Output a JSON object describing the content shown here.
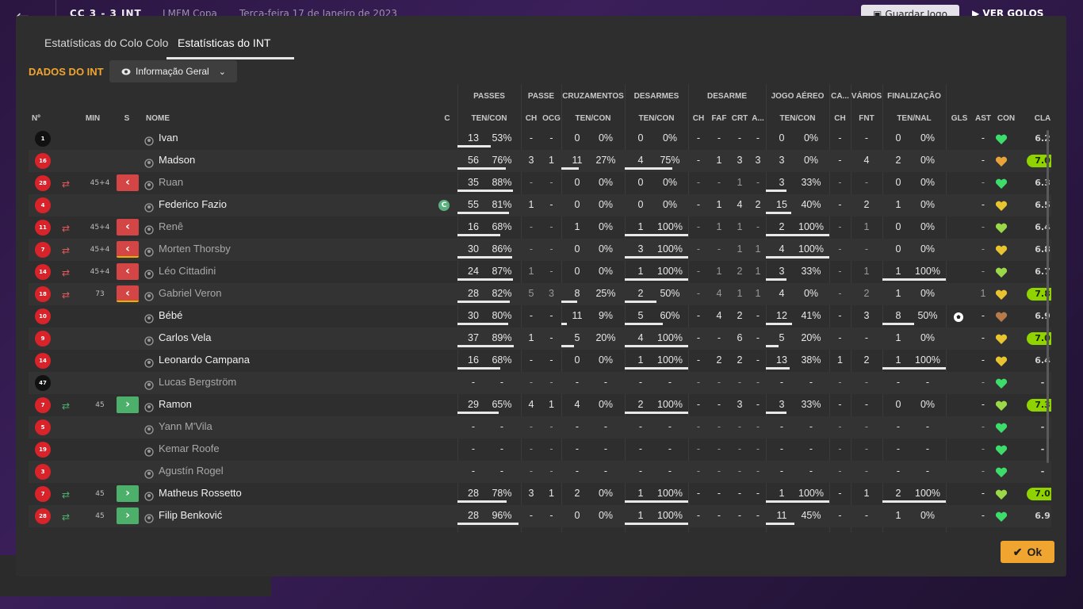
{
  "background": {
    "score": "CC 3 - 3 INT",
    "competition": "LMFM Copa",
    "date": "Terça-feira 17 de Janeiro de 2023",
    "save_label": "Guardar Jogo",
    "play_label": "VER GOLOS"
  },
  "tabs": [
    {
      "label": "Estatísticas do Colo Colo",
      "active": false
    },
    {
      "label": "Estatísticas do INT",
      "active": true
    }
  ],
  "section_title": "DADOS DO INT",
  "view_dropdown": {
    "selected": "Informação Geral",
    "icon": "eye-icon"
  },
  "headers": {
    "groups": {
      "passes": "PASSES",
      "passe": "PASSE",
      "cruzamentos": "CRUZAMENTOS",
      "desarmes": "DESARMES",
      "desarme": "DESARME",
      "jogo_aereo": "JOGO AÉREO",
      "ca": "CA...",
      "varios": "VÁRIOS",
      "finalizacao": "FINALIZAÇÃO"
    },
    "sub": {
      "num": "Nº",
      "min": "MIN",
      "s": "S",
      "name": "NOME",
      "c": "C",
      "passes": "TEN/CON",
      "passe_ch": "CH",
      "passe_ocg": "OCG",
      "cruz": "TEN/CON",
      "desarmes": "TEN/CON",
      "d_ch": "CH",
      "d_faf": "FAF",
      "d_crt": "CRT",
      "d_a": "A...",
      "aereo": "TEN/CON",
      "ca_ch": "CH",
      "fnt": "FNT",
      "fin": "TEN/NAL",
      "gls": "GLS",
      "ast": "AST",
      "con": "CON",
      "cla": "CLA"
    }
  },
  "colors": {
    "accent": "#f0a531",
    "sub_out": "#d44545",
    "sub_in": "#4caf6a",
    "rating_green": "#8fd400"
  },
  "players": [
    {
      "num": "1",
      "gk": true,
      "sub": "",
      "min": "",
      "name": "Ivan",
      "dim": false,
      "captain": false,
      "pa": "13",
      "pp": "53%",
      "pf": 0.53,
      "pch": "-",
      "pocg": "-",
      "ca": "0",
      "cp": "0%",
      "cf": 0,
      "da": "0",
      "dp": "0%",
      "df": 0,
      "dch": "-",
      "faf": "-",
      "crt": "-",
      "da2": "-",
      "aa": "0",
      "ap": "0%",
      "af": 0,
      "cach": "-",
      "fnt": "-",
      "fa": "0",
      "fp": "0%",
      "ff": 0,
      "gls": "",
      "ast": "-",
      "con": "green",
      "cla": "6.2",
      "cla_hi": false
    },
    {
      "num": "16",
      "gk": false,
      "sub": "",
      "min": "",
      "name": "Madson",
      "dim": false,
      "captain": false,
      "pa": "56",
      "pp": "76%",
      "pf": 0.76,
      "pch": "3",
      "pocg": "1",
      "ca": "11",
      "cp": "27%",
      "cf": 0.27,
      "da": "4",
      "dp": "75%",
      "df": 0.75,
      "dch": "-",
      "faf": "1",
      "crt": "3",
      "da2": "3",
      "aa": "3",
      "ap": "0%",
      "af": 0,
      "cach": "-",
      "fnt": "4",
      "fa": "2",
      "fp": "0%",
      "ff": 0,
      "gls": "",
      "ast": "-",
      "con": "orange",
      "cla": "7.0",
      "cla_hi": true
    },
    {
      "num": "28",
      "gk": false,
      "sub": "out",
      "min": "45+4",
      "name": "Ruan",
      "dim": true,
      "captain": false,
      "yellow": false,
      "pa": "35",
      "pp": "88%",
      "pf": 0.88,
      "pch": "-",
      "pocg": "-",
      "ca": "0",
      "cp": "0%",
      "cf": 0,
      "da": "0",
      "dp": "0%",
      "df": 0,
      "dch": "-",
      "faf": "-",
      "crt": "1",
      "da2": "-",
      "aa": "3",
      "ap": "33%",
      "af": 0.33,
      "cach": "-",
      "fnt": "-",
      "fa": "0",
      "fp": "0%",
      "ff": 0,
      "gls": "",
      "ast": "-",
      "con": "green",
      "cla": "6.3",
      "cla_hi": false
    },
    {
      "num": "4",
      "gk": false,
      "sub": "",
      "min": "",
      "name": "Federico Fazio",
      "dim": false,
      "captain": true,
      "pa": "55",
      "pp": "81%",
      "pf": 0.81,
      "pch": "1",
      "pocg": "-",
      "ca": "0",
      "cp": "0%",
      "cf": 0,
      "da": "0",
      "dp": "0%",
      "df": 0,
      "dch": "-",
      "faf": "1",
      "crt": "4",
      "da2": "2",
      "aa": "15",
      "ap": "40%",
      "af": 0.4,
      "cach": "-",
      "fnt": "2",
      "fa": "1",
      "fp": "0%",
      "ff": 0,
      "gls": "",
      "ast": "-",
      "con": "yellow",
      "cla": "6.5",
      "cla_hi": false
    },
    {
      "num": "11",
      "gk": false,
      "sub": "out",
      "min": "45+4",
      "name": "Renê",
      "dim": true,
      "captain": false,
      "yellow": false,
      "pa": "16",
      "pp": "68%",
      "pf": 0.68,
      "pch": "-",
      "pocg": "-",
      "ca": "1",
      "cp": "0%",
      "cf": 0,
      "da": "1",
      "dp": "100%",
      "df": 1,
      "dch": "-",
      "faf": "1",
      "crt": "1",
      "da2": "-",
      "aa": "2",
      "ap": "100%",
      "af": 1,
      "cach": "-",
      "fnt": "1",
      "fa": "0",
      "fp": "0%",
      "ff": 0,
      "gls": "",
      "ast": "-",
      "con": "lime",
      "cla": "6.4",
      "cla_hi": false
    },
    {
      "num": "7",
      "gk": false,
      "sub": "out",
      "min": "45+4",
      "name": "Morten Thorsby",
      "dim": true,
      "captain": false,
      "yellow": true,
      "pa": "30",
      "pp": "86%",
      "pf": 0.86,
      "pch": "-",
      "pocg": "-",
      "ca": "0",
      "cp": "0%",
      "cf": 0,
      "da": "3",
      "dp": "100%",
      "df": 1,
      "dch": "-",
      "faf": "-",
      "crt": "1",
      "da2": "1",
      "aa": "4",
      "ap": "100%",
      "af": 1,
      "cach": "-",
      "fnt": "-",
      "fa": "0",
      "fp": "0%",
      "ff": 0,
      "gls": "",
      "ast": "-",
      "con": "yellow",
      "cla": "6.8",
      "cla_hi": false
    },
    {
      "num": "14",
      "gk": false,
      "sub": "out",
      "min": "45+4",
      "name": "Léo Cittadini",
      "dim": true,
      "captain": false,
      "yellow": false,
      "pa": "24",
      "pp": "87%",
      "pf": 0.87,
      "pch": "1",
      "pocg": "-",
      "ca": "0",
      "cp": "0%",
      "cf": 0,
      "da": "1",
      "dp": "100%",
      "df": 1,
      "dch": "-",
      "faf": "1",
      "crt": "2",
      "da2": "1",
      "aa": "3",
      "ap": "33%",
      "af": 0.33,
      "cach": "-",
      "fnt": "1",
      "fa": "1",
      "fp": "100%",
      "ff": 1,
      "gls": "",
      "ast": "-",
      "con": "lime",
      "cla": "6.7",
      "cla_hi": false
    },
    {
      "num": "18",
      "gk": false,
      "sub": "out",
      "min": "73",
      "name": "Gabriel Veron",
      "dim": true,
      "captain": false,
      "yellow": true,
      "pa": "28",
      "pp": "82%",
      "pf": 0.82,
      "pch": "5",
      "pocg": "3",
      "ca": "8",
      "cp": "25%",
      "cf": 0.25,
      "da": "2",
      "dp": "50%",
      "df": 0.5,
      "dch": "-",
      "faf": "4",
      "crt": "1",
      "da2": "1",
      "aa": "4",
      "ap": "0%",
      "af": 0,
      "cach": "-",
      "fnt": "2",
      "fa": "1",
      "fp": "0%",
      "ff": 0,
      "gls": "",
      "ast": "1",
      "con": "yellow",
      "cla": "7.8",
      "cla_hi": true
    },
    {
      "num": "10",
      "gk": false,
      "sub": "",
      "min": "",
      "name": "Bébé",
      "dim": false,
      "captain": false,
      "pa": "30",
      "pp": "80%",
      "pf": 0.8,
      "pch": "-",
      "pocg": "-",
      "ca": "11",
      "cp": "9%",
      "cf": 0.09,
      "da": "5",
      "dp": "60%",
      "df": 0.6,
      "dch": "-",
      "faf": "4",
      "crt": "2",
      "da2": "-",
      "aa": "12",
      "ap": "41%",
      "af": 0.41,
      "cach": "-",
      "fnt": "3",
      "fa": "8",
      "fp": "50%",
      "ff": 0.5,
      "gls": "ball",
      "ast": "-",
      "con": "brown",
      "cla": "6.9",
      "cla_hi": false
    },
    {
      "num": "9",
      "gk": false,
      "sub": "",
      "min": "",
      "name": "Carlos Vela",
      "dim": false,
      "captain": false,
      "pa": "37",
      "pp": "89%",
      "pf": 0.89,
      "pch": "1",
      "pocg": "-",
      "ca": "5",
      "cp": "20%",
      "cf": 0.2,
      "da": "4",
      "dp": "100%",
      "df": 1,
      "dch": "-",
      "faf": "-",
      "crt": "6",
      "da2": "-",
      "aa": "5",
      "ap": "20%",
      "af": 0.2,
      "cach": "-",
      "fnt": "-",
      "fa": "1",
      "fp": "0%",
      "ff": 0,
      "gls": "",
      "ast": "-",
      "con": "yellow",
      "cla": "7.0",
      "cla_hi": true
    },
    {
      "num": "14",
      "gk": false,
      "sub": "",
      "min": "",
      "name": "Leonardo Campana",
      "dim": false,
      "captain": false,
      "pa": "16",
      "pp": "68%",
      "pf": 0.68,
      "pch": "-",
      "pocg": "-",
      "ca": "0",
      "cp": "0%",
      "cf": 0,
      "da": "1",
      "dp": "100%",
      "df": 1,
      "dch": "-",
      "faf": "2",
      "crt": "2",
      "da2": "-",
      "aa": "13",
      "ap": "38%",
      "af": 0.38,
      "cach": "1",
      "fnt": "2",
      "fa": "1",
      "fp": "100%",
      "ff": 1,
      "gls": "",
      "ast": "-",
      "con": "yellow",
      "cla": "6.4",
      "cla_hi": false
    },
    {
      "num": "47",
      "gk": true,
      "sub": "",
      "min": "",
      "name": "Lucas Bergström",
      "dim": true,
      "captain": false,
      "pa": "-",
      "pp": "-",
      "pf": 0,
      "pch": "-",
      "pocg": "-",
      "ca": "-",
      "cp": "-",
      "cf": 0,
      "da": "-",
      "dp": "-",
      "df": 0,
      "dch": "-",
      "faf": "-",
      "crt": "-",
      "da2": "-",
      "aa": "-",
      "ap": "-",
      "af": 0,
      "cach": "-",
      "fnt": "-",
      "fa": "-",
      "fp": "-",
      "ff": 0,
      "gls": "",
      "ast": "-",
      "con": "green",
      "cla": "-",
      "cla_hi": false
    },
    {
      "num": "7",
      "gk": false,
      "sub": "in",
      "min": "45",
      "name": "Ramon",
      "dim": false,
      "captain": false,
      "pa": "29",
      "pp": "65%",
      "pf": 0.65,
      "pch": "4",
      "pocg": "1",
      "ca": "4",
      "cp": "0%",
      "cf": 0,
      "da": "2",
      "dp": "100%",
      "df": 1,
      "dch": "-",
      "faf": "-",
      "crt": "3",
      "da2": "-",
      "aa": "3",
      "ap": "33%",
      "af": 0.33,
      "cach": "-",
      "fnt": "-",
      "fa": "0",
      "fp": "0%",
      "ff": 0,
      "gls": "",
      "ast": "-",
      "con": "lime",
      "cla": "7.3",
      "cla_hi": true
    },
    {
      "num": "5",
      "gk": false,
      "sub": "",
      "min": "",
      "name": "Yann M'Vila",
      "dim": true,
      "captain": false,
      "pa": "-",
      "pp": "-",
      "pf": 0,
      "pch": "-",
      "pocg": "-",
      "ca": "-",
      "cp": "-",
      "cf": 0,
      "da": "-",
      "dp": "-",
      "df": 0,
      "dch": "-",
      "faf": "-",
      "crt": "-",
      "da2": "-",
      "aa": "-",
      "ap": "-",
      "af": 0,
      "cach": "-",
      "fnt": "-",
      "fa": "-",
      "fp": "-",
      "ff": 0,
      "gls": "",
      "ast": "-",
      "con": "green",
      "cla": "-",
      "cla_hi": false
    },
    {
      "num": "19",
      "gk": false,
      "sub": "",
      "min": "",
      "name": "Kemar Roofe",
      "dim": true,
      "captain": false,
      "pa": "-",
      "pp": "-",
      "pf": 0,
      "pch": "-",
      "pocg": "-",
      "ca": "-",
      "cp": "-",
      "cf": 0,
      "da": "-",
      "dp": "-",
      "df": 0,
      "dch": "-",
      "faf": "-",
      "crt": "-",
      "da2": "-",
      "aa": "-",
      "ap": "-",
      "af": 0,
      "cach": "-",
      "fnt": "-",
      "fa": "-",
      "fp": "-",
      "ff": 0,
      "gls": "",
      "ast": "-",
      "con": "green",
      "cla": "-",
      "cla_hi": false
    },
    {
      "num": "3",
      "gk": false,
      "sub": "",
      "min": "",
      "name": "Agustín Rogel",
      "dim": true,
      "captain": false,
      "pa": "-",
      "pp": "-",
      "pf": 0,
      "pch": "-",
      "pocg": "-",
      "ca": "-",
      "cp": "-",
      "cf": 0,
      "da": "-",
      "dp": "-",
      "df": 0,
      "dch": "-",
      "faf": "-",
      "crt": "-",
      "da2": "-",
      "aa": "-",
      "ap": "-",
      "af": 0,
      "cach": "-",
      "fnt": "-",
      "fa": "-",
      "fp": "-",
      "ff": 0,
      "gls": "",
      "ast": "-",
      "con": "green",
      "cla": "-",
      "cla_hi": false
    },
    {
      "num": "7",
      "gk": false,
      "sub": "in",
      "min": "45",
      "name": "Matheus Rossetto",
      "dim": false,
      "captain": false,
      "pa": "28",
      "pp": "78%",
      "pf": 0.78,
      "pch": "3",
      "pocg": "1",
      "ca": "2",
      "cp": "0%",
      "cf": 0,
      "da": "1",
      "dp": "100%",
      "df": 1,
      "dch": "-",
      "faf": "-",
      "crt": "-",
      "da2": "-",
      "aa": "1",
      "ap": "100%",
      "af": 1,
      "cach": "-",
      "fnt": "1",
      "fa": "2",
      "fp": "100%",
      "ff": 1,
      "gls": "",
      "ast": "-",
      "con": "lime",
      "cla": "7.0",
      "cla_hi": true
    },
    {
      "num": "28",
      "gk": false,
      "sub": "in",
      "min": "45",
      "name": "Filip Benković",
      "dim": false,
      "captain": false,
      "pa": "28",
      "pp": "96%",
      "pf": 0.96,
      "pch": "-",
      "pocg": "-",
      "ca": "0",
      "cp": "0%",
      "cf": 0,
      "da": "1",
      "dp": "100%",
      "df": 1,
      "dch": "-",
      "faf": "-",
      "crt": "-",
      "da2": "-",
      "aa": "11",
      "ap": "45%",
      "af": 0.45,
      "cach": "-",
      "fnt": "-",
      "fa": "1",
      "fp": "0%",
      "ff": 0,
      "gls": "",
      "ast": "-",
      "con": "green",
      "cla": "6.9",
      "cla_hi": false
    }
  ],
  "ok_label": "Ok"
}
